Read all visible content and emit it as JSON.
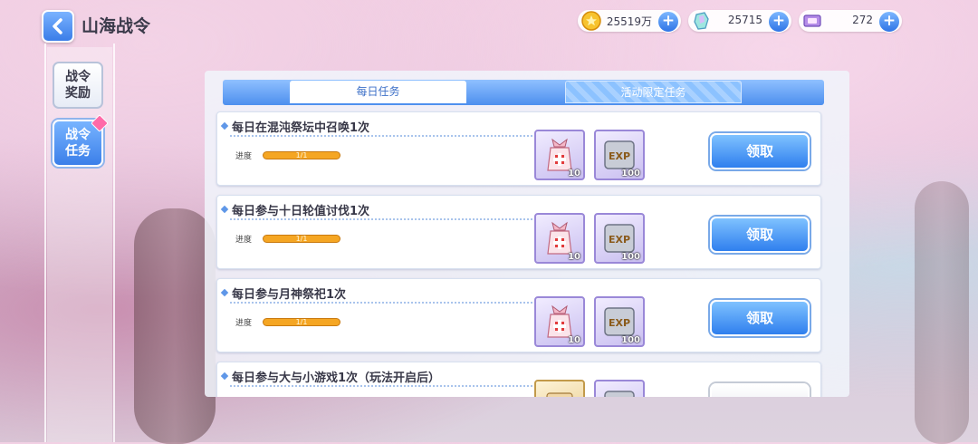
{
  "header": {
    "title": "山海战令"
  },
  "resources": [
    {
      "icon": "gold-coin-icon",
      "value": "25519万"
    },
    {
      "icon": "crystal-icon",
      "value": "25715"
    },
    {
      "icon": "ticket-icon",
      "value": "272"
    }
  ],
  "sidebar": {
    "items": [
      {
        "label": "战令奖励",
        "active": false
      },
      {
        "label": "战令任务",
        "active": true,
        "badge": true
      }
    ]
  },
  "tabs": [
    {
      "label": "每日任务",
      "active": true
    },
    {
      "label": "活动限定任务",
      "active": false
    }
  ],
  "tasks": [
    {
      "title": "每日在混沌祭坛中召唤1次",
      "progress_label": "进度",
      "progress": "1/1",
      "progress_fraction": 1.0,
      "rewards": [
        {
          "icon": "gift-bag-icon",
          "qty": "10"
        },
        {
          "icon": "exp-card-icon",
          "qty": "100"
        }
      ],
      "button": "领取"
    },
    {
      "title": "每日参与十日轮值讨伐1次",
      "progress_label": "进度",
      "progress": "1/1",
      "progress_fraction": 1.0,
      "rewards": [
        {
          "icon": "gift-bag-icon",
          "qty": "10"
        },
        {
          "icon": "exp-card-icon",
          "qty": "100"
        }
      ],
      "button": "领取"
    },
    {
      "title": "每日参与月神祭祀1次",
      "progress_label": "进度",
      "progress": "1/1",
      "progress_fraction": 1.0,
      "rewards": [
        {
          "icon": "gift-bag-icon",
          "qty": "10"
        },
        {
          "icon": "exp-card-icon",
          "qty": "100"
        }
      ],
      "button": "领取"
    },
    {
      "title": "每日参与大与小游戏1次（玩法开启后）",
      "rewards": [
        {
          "icon": "gift-bag-icon"
        },
        {
          "icon": "exp-card-icon"
        }
      ]
    }
  ],
  "colors": {
    "accent": "#3b7fe9",
    "progress": "#f5a623",
    "badge": "#ff6aa8"
  }
}
